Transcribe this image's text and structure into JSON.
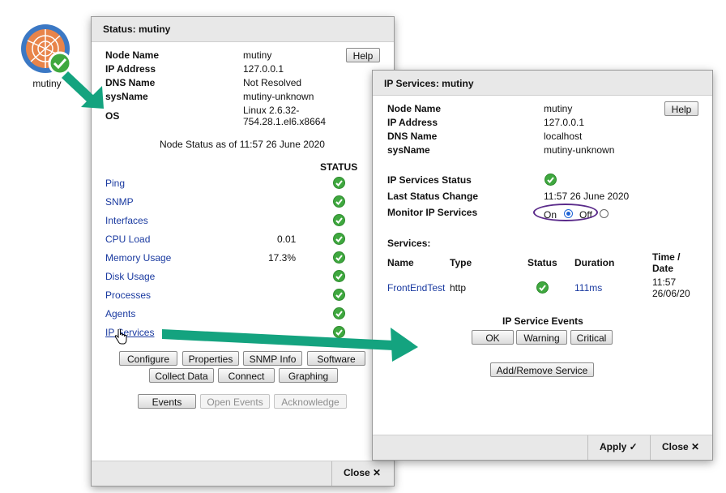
{
  "desktop": {
    "node_label": "mutiny"
  },
  "status_window": {
    "title": "Status: mutiny",
    "help_label": "Help",
    "fields": [
      {
        "label": "Node Name",
        "value": "mutiny"
      },
      {
        "label": "IP Address",
        "value": "127.0.0.1"
      },
      {
        "label": "DNS Name",
        "value": "Not Resolved"
      },
      {
        "label": "sysName",
        "value": "mutiny-unknown"
      },
      {
        "label": "OS",
        "value_line1": "Linux 2.6.32-",
        "value_line2": "754.28.1.el6.x8664"
      }
    ],
    "node_status_text": "Node Status as of 11:57 26 June 2020",
    "status_header": "STATUS",
    "checks": [
      {
        "name": "Ping",
        "value": ""
      },
      {
        "name": "SNMP",
        "value": ""
      },
      {
        "name": "Interfaces",
        "value": ""
      },
      {
        "name": "CPU Load",
        "value": "0.01"
      },
      {
        "name": "Memory Usage",
        "value": "17.3%"
      },
      {
        "name": "Disk Usage",
        "value": ""
      },
      {
        "name": "Processes",
        "value": ""
      },
      {
        "name": "Agents",
        "value": ""
      },
      {
        "name": "IP Services",
        "value": ""
      }
    ],
    "buttons_row1": [
      "Configure",
      "Properties",
      "SNMP Info",
      "Software"
    ],
    "buttons_row2": [
      "Collect Data",
      "Connect",
      "Graphing"
    ],
    "buttons_row3": [
      "Events",
      "Open Events",
      "Acknowledge"
    ],
    "close_label": "Close ✕"
  },
  "ip_window": {
    "title": "IP Services: mutiny",
    "help_label": "Help",
    "fields": [
      {
        "label": "Node Name",
        "value": "mutiny"
      },
      {
        "label": "IP Address",
        "value": "127.0.0.1"
      },
      {
        "label": "DNS Name",
        "value": "localhost"
      },
      {
        "label": "sysName",
        "value": "mutiny-unknown"
      }
    ],
    "ip_services_status_label": "IP Services Status",
    "last_status_change_label": "Last Status Change",
    "last_status_change_value": "11:57 26 June 2020",
    "monitor_label": "Monitor IP Services",
    "monitor_on": "On",
    "monitor_off": "Off",
    "monitor_selected": "On",
    "services_heading": "Services:",
    "table_headers": {
      "name": "Name",
      "type": "Type",
      "status": "Status",
      "duration": "Duration",
      "time_line1": "Time /",
      "time_line2": "Date"
    },
    "services": [
      {
        "name": "FrontEndTest",
        "type": "http",
        "duration": "111ms",
        "time": "11:57",
        "date": "26/06/20"
      }
    ],
    "events_heading": "IP Service Events",
    "event_buttons": [
      "OK",
      "Warning",
      "Critical"
    ],
    "add_remove_label": "Add/Remove Service",
    "apply_label": "Apply ✓",
    "close_label": "Close ✕"
  },
  "colors": {
    "status_ok": "#3fa83f",
    "link": "#1a3aa0",
    "annotation_arrow": "#14a37f",
    "highlight_oval": "#5a2a8a"
  }
}
